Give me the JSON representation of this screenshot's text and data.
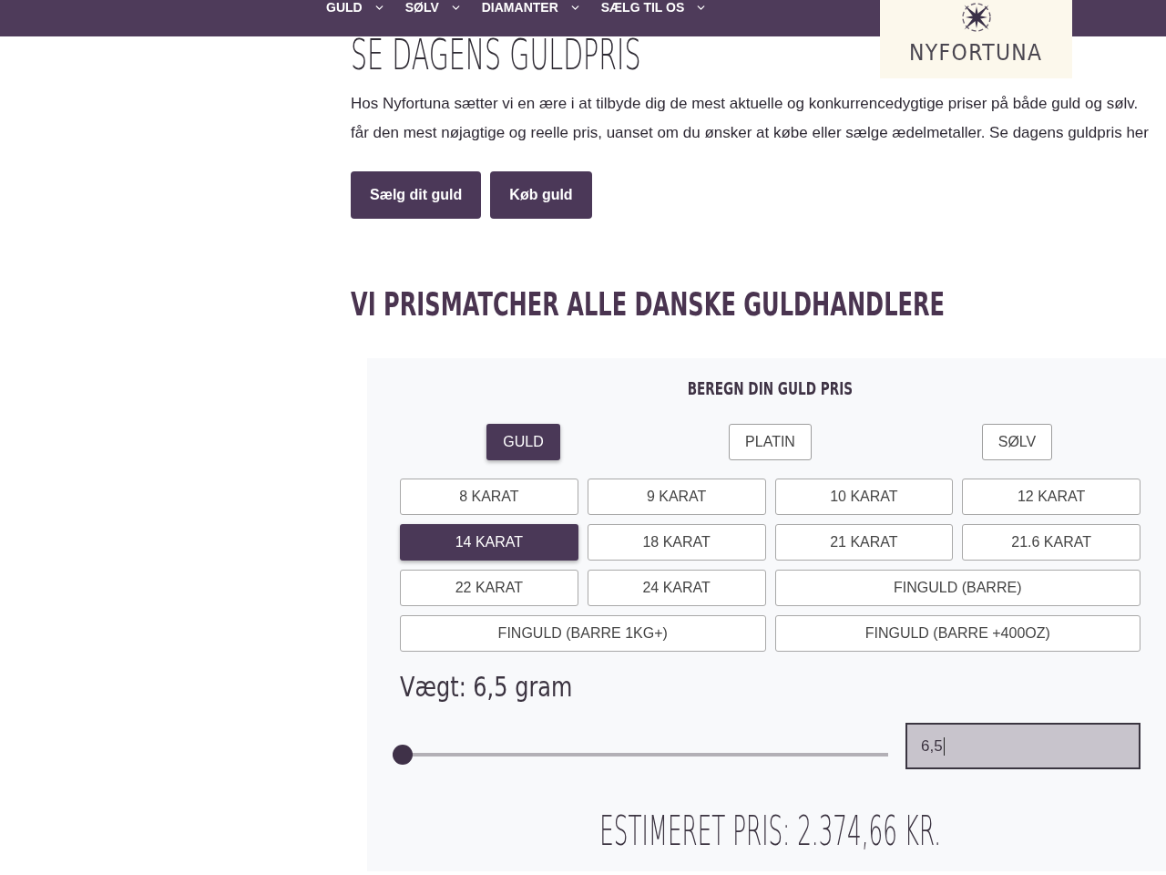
{
  "nav": {
    "items": [
      {
        "label": "GULD"
      },
      {
        "label": "SØLV"
      },
      {
        "label": "DIAMANTER"
      },
      {
        "label": "SÆLG TIL OS"
      }
    ]
  },
  "logo": {
    "text": "NYFORTUNA"
  },
  "hero": {
    "title": "SE DAGENS GULDPRIS",
    "intro": [
      "Hos Nyfortuna sætter vi en ære i at tilbyde dig de mest aktuelle og konkurrencedygtige priser på både guld og sølv.",
      "får den mest nøjagtige og reelle pris, uanset om du ønsker at købe eller sælge ædelmetaller. Se dagens guldpris her"
    ],
    "buttons": [
      "Sælg dit guld",
      "Køb guld"
    ]
  },
  "section": {
    "title": "VI PRISMATCHER ALLE DANSKE GULDHANDLERE"
  },
  "calculator": {
    "title": "BEREGN DIN GULD PRIS",
    "metals": [
      {
        "label": "GULD",
        "selected": true
      },
      {
        "label": "PLATIN",
        "selected": false
      },
      {
        "label": "SØLV",
        "selected": false
      }
    ],
    "karats": [
      {
        "label": "8 KARAT",
        "kind": "single",
        "selected": false
      },
      {
        "label": "9 KARAT",
        "kind": "single",
        "selected": false
      },
      {
        "label": "10 KARAT",
        "kind": "single",
        "selected": false
      },
      {
        "label": "12 KARAT",
        "kind": "single",
        "selected": false
      },
      {
        "label": "14 KARAT",
        "kind": "single",
        "selected": true
      },
      {
        "label": "18 KARAT",
        "kind": "single",
        "selected": false
      },
      {
        "label": "21 KARAT",
        "kind": "single",
        "selected": false
      },
      {
        "label": "21.6 KARAT",
        "kind": "single",
        "selected": false
      },
      {
        "label": "22 KARAT",
        "kind": "single",
        "selected": false
      },
      {
        "label": "24 KARAT",
        "kind": "single",
        "selected": false
      },
      {
        "label": "FINGULD (BARRE)",
        "kind": "wide",
        "selected": false
      },
      {
        "label": "FINGULD (BARRE 1KG+)",
        "kind": "wide",
        "selected": false
      },
      {
        "label": "FINGULD (BARRE +400OZ)",
        "kind": "wide",
        "selected": false
      }
    ],
    "weight": {
      "label": "Vægt: 6,5 gram",
      "level": 0,
      "value": "6,5",
      "focused": true
    },
    "estimate": "ESTIMERET PRIS: 2.374,66 KR."
  }
}
